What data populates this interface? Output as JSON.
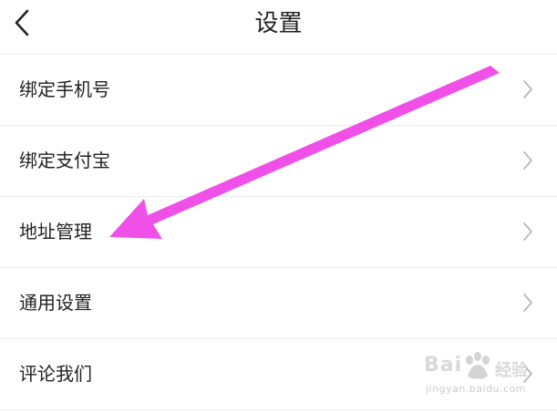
{
  "header": {
    "title": "设置",
    "back_icon": "chevron-left-icon"
  },
  "settings": {
    "items": [
      {
        "label": "绑定手机号",
        "icon": "chevron-right-icon"
      },
      {
        "label": "绑定支付宝",
        "icon": "chevron-right-icon"
      },
      {
        "label": "地址管理",
        "icon": "chevron-right-icon"
      },
      {
        "label": "通用设置",
        "icon": "chevron-right-icon"
      },
      {
        "label": "评论我们",
        "icon": "chevron-right-icon"
      }
    ]
  },
  "annotation": {
    "type": "arrow",
    "color": "#f050e8",
    "points_to": "地址管理"
  },
  "watermark": {
    "brand": "Bai",
    "brand_suffix": "经验",
    "url": "jingyan.baidu.com"
  },
  "colors": {
    "background": "#ffffff",
    "text": "#222222",
    "divider": "#ececec",
    "chevron": "#b8b8b8"
  }
}
